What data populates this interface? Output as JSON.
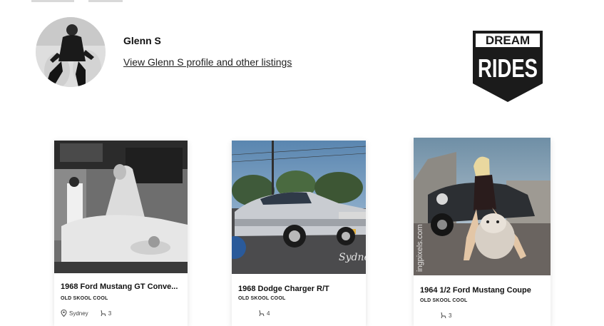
{
  "seller": {
    "name": "Glenn S",
    "profile_link": "View Glenn S profile and other listings"
  },
  "brand": {
    "line1": "DREAM",
    "line2": "RIDES"
  },
  "listings": [
    {
      "title": "1968 Ford Mustang GT Conve...",
      "category": "OLD SKOOL COOL",
      "location": "Sydney",
      "seats": "3"
    },
    {
      "title": "1968 Dodge Charger R/T",
      "category": "OLD SKOOL COOL",
      "location": "",
      "seats": "4",
      "watermark": "Sydne"
    },
    {
      "title": "1964 1/2 Ford Mustang Coupe",
      "category": "OLD SKOOL COOL",
      "location": "",
      "seats": "3",
      "watermark": "ingpixels.com"
    }
  ],
  "icons": {
    "location": "map-pin-icon",
    "seats": "car-seat-icon"
  },
  "colors": {
    "brand_bg": "#1b1b1b",
    "brand_text": "#ffffff"
  }
}
